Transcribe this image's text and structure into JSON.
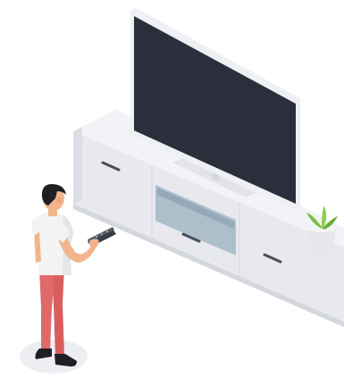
{
  "illustration": {
    "subject": "person-with-remote-watching-tv",
    "colors": {
      "background": "#ffffff",
      "tv_screen": "#2b2e3b",
      "tv_frame": "#eef0f4",
      "cabinet_top": "#f2f3f6",
      "cabinet_front": "#e8e9ee",
      "cabinet_side": "#d9dbe2",
      "shelf_glass": "#aebfcc",
      "shirt": "#f3f3f3",
      "pants": "#e06a6a",
      "hair": "#1f1f24",
      "skin": "#f2b58b",
      "plant": "#7bc043",
      "pot": "#e6e7ec",
      "shadow": "#eceef2"
    },
    "icons": [
      "tv-icon",
      "remote-control-icon",
      "potted-plant-icon",
      "person-icon"
    ]
  }
}
